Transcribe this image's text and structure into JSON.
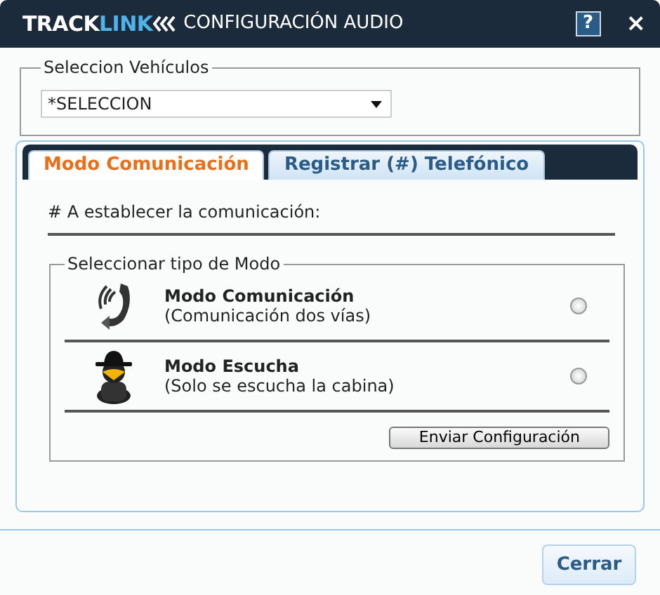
{
  "window": {
    "logo": {
      "part_1": "TRACK",
      "part_2": "LINK"
    },
    "title": "CONFIGURACIÓN AUDIO",
    "help": "?",
    "close": "×"
  },
  "vehicle_group": {
    "legend": "Seleccion Vehículos",
    "select": {
      "value": "*SELECCION"
    }
  },
  "tabs": [
    {
      "label": "Modo Comunicación",
      "selected": true
    },
    {
      "label": "Registrar (#) Telefónico",
      "selected": false
    }
  ],
  "tab_content": {
    "heading": "# A establecer la comunicación:",
    "mode_group": {
      "legend": "Seleccionar tipo de Modo",
      "modes": [
        {
          "kind": "phone",
          "title": "Modo Comunicación",
          "subtitle": "(Comunicación dos vías)",
          "selected": false
        },
        {
          "kind": "spy",
          "title": "Modo Escucha",
          "subtitle": "(Solo se escucha la cabina)",
          "selected": false
        }
      ],
      "button": "Enviar Configuración"
    }
  },
  "footer": {
    "button": "Cerrar"
  }
}
